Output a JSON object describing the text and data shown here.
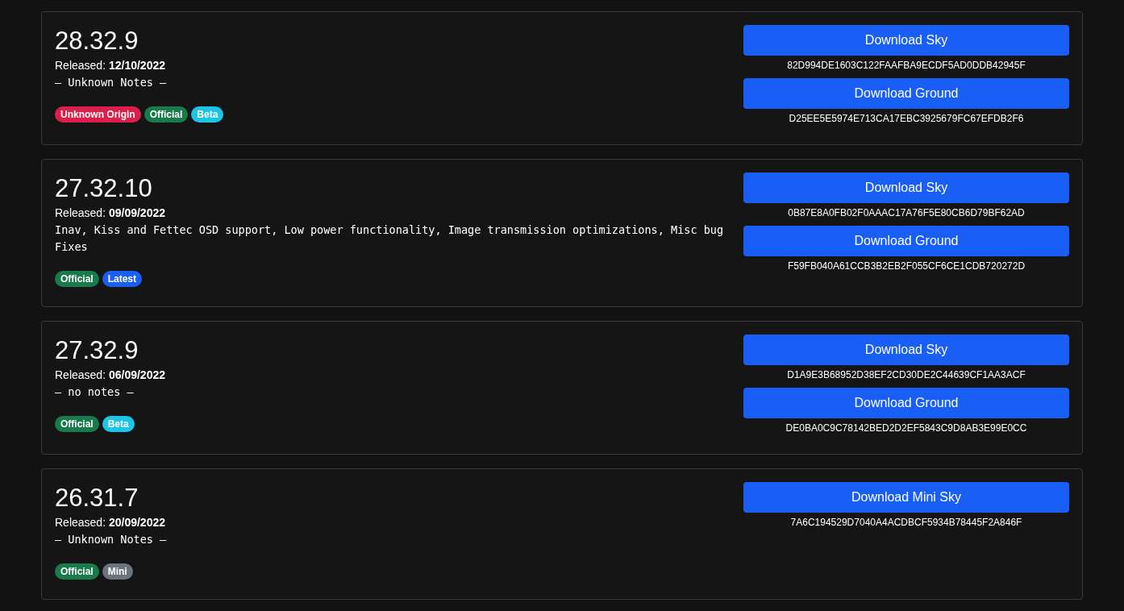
{
  "releases": [
    {
      "version": "28.32.9",
      "released_label": "Released:",
      "released_date": "12/10/2022",
      "notes": "– Unknown Notes –",
      "badges": [
        {
          "label": "Unknown Origin",
          "color": "#dc1f4a"
        },
        {
          "label": "Official",
          "color": "#197b4c"
        },
        {
          "label": "Beta",
          "color": "#1cc4e6"
        }
      ],
      "downloads": [
        {
          "label": "Download Sky",
          "hash": "82D994DE1603C122FAAFBA9ECDF5AD0DDB42945F"
        },
        {
          "label": "Download Ground",
          "hash": "D25EE5E5974E713CA17EBC3925679FC67EFDB2F6"
        }
      ]
    },
    {
      "version": "27.32.10",
      "released_label": "Released:",
      "released_date": "09/09/2022",
      "notes": "Inav, Kiss and Fettec OSD support, Low power functionality, Image transmission optimizations, Misc bug Fixes",
      "badges": [
        {
          "label": "Official",
          "color": "#197b4c"
        },
        {
          "label": "Latest",
          "color": "#1a5ff5"
        }
      ],
      "downloads": [
        {
          "label": "Download Sky",
          "hash": "0B87E8A0FB02F0AAAC17A76F5E80CB6D79BF62AD"
        },
        {
          "label": "Download Ground",
          "hash": "F59FB040A61CCB3B2EB2F055CF6CE1CDB720272D"
        }
      ]
    },
    {
      "version": "27.32.9",
      "released_label": "Released:",
      "released_date": "06/09/2022",
      "notes": "– no notes –",
      "badges": [
        {
          "label": "Official",
          "color": "#197b4c"
        },
        {
          "label": "Beta",
          "color": "#1cc4e6"
        }
      ],
      "downloads": [
        {
          "label": "Download Sky",
          "hash": "D1A9E3B68952D38EF2CD30DE2C44639CF1AA3ACF"
        },
        {
          "label": "Download Ground",
          "hash": "DE0BA0C9C78142BED2D2EF5843C9D8AB3E99E0CC"
        }
      ]
    },
    {
      "version": "26.31.7",
      "released_label": "Released:",
      "released_date": "20/09/2022",
      "notes": "– Unknown Notes –",
      "badges": [
        {
          "label": "Official",
          "color": "#197b4c"
        },
        {
          "label": "Mini",
          "color": "#6b737b"
        }
      ],
      "downloads": [
        {
          "label": "Download Mini Sky",
          "hash": "7A6C194529D7040A4ACDBCF5934B78445F2A846F"
        }
      ]
    }
  ]
}
